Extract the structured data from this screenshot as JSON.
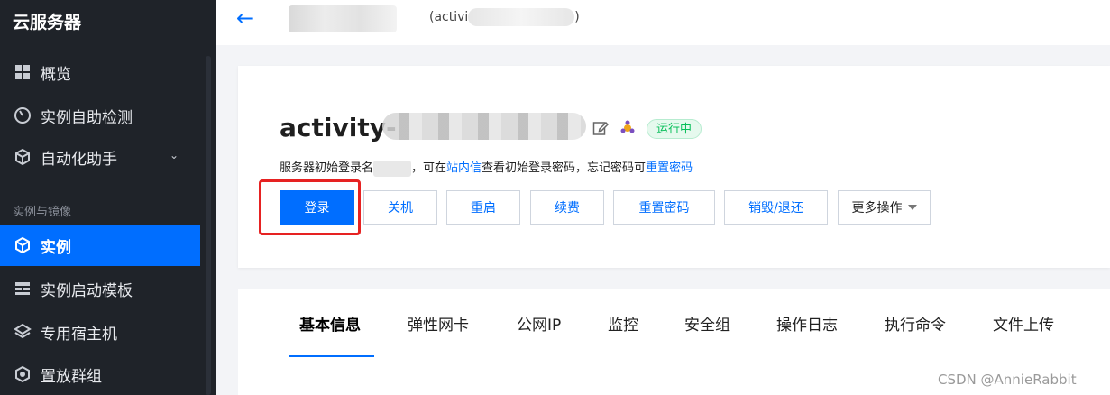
{
  "sidebar": {
    "brand": "云服务器",
    "items": [
      {
        "label": "概览",
        "icon": "grid-icon"
      },
      {
        "label": "实例自助检测",
        "icon": "gauge-icon"
      },
      {
        "label": "自动化助手",
        "icon": "cube-icon",
        "chevron": "⌄"
      },
      {
        "label": "实例",
        "icon": "cube-icon",
        "active": true
      },
      {
        "label": "实例启动模板",
        "icon": "template-icon"
      },
      {
        "label": "专用宿主机",
        "icon": "layers-icon"
      },
      {
        "label": "置放群组",
        "icon": "hexagon-icon"
      }
    ],
    "section_label": "实例与镜像"
  },
  "topbar": {
    "back_icon": "←",
    "instance_paren": "(activi",
    "instance_paren_close": ")"
  },
  "instance": {
    "name": "activity-",
    "status": "运行中",
    "hint_prefix": "服务器初始登录名",
    "hint_middle": "，可在",
    "hint_link1": "站内信",
    "hint_after": "查看初始登录密码，忘记密码可",
    "hint_link2": "重置密码"
  },
  "actions": {
    "login": "登录",
    "shutdown": "关机",
    "restart": "重启",
    "renew": "续费",
    "reset_password": "重置密码",
    "destroy": "销毁/退还",
    "more": "更多操作"
  },
  "tabs": [
    "基本信息",
    "弹性网卡",
    "公网IP",
    "监控",
    "安全组",
    "操作日志",
    "执行命令",
    "文件上传"
  ],
  "watermark": "CSDN @AnnieRabbit",
  "colors": {
    "accent": "#006eff",
    "sidebar_bg": "#1f2329",
    "status_green": "#0abf5b",
    "highlight_red": "#e62222"
  }
}
